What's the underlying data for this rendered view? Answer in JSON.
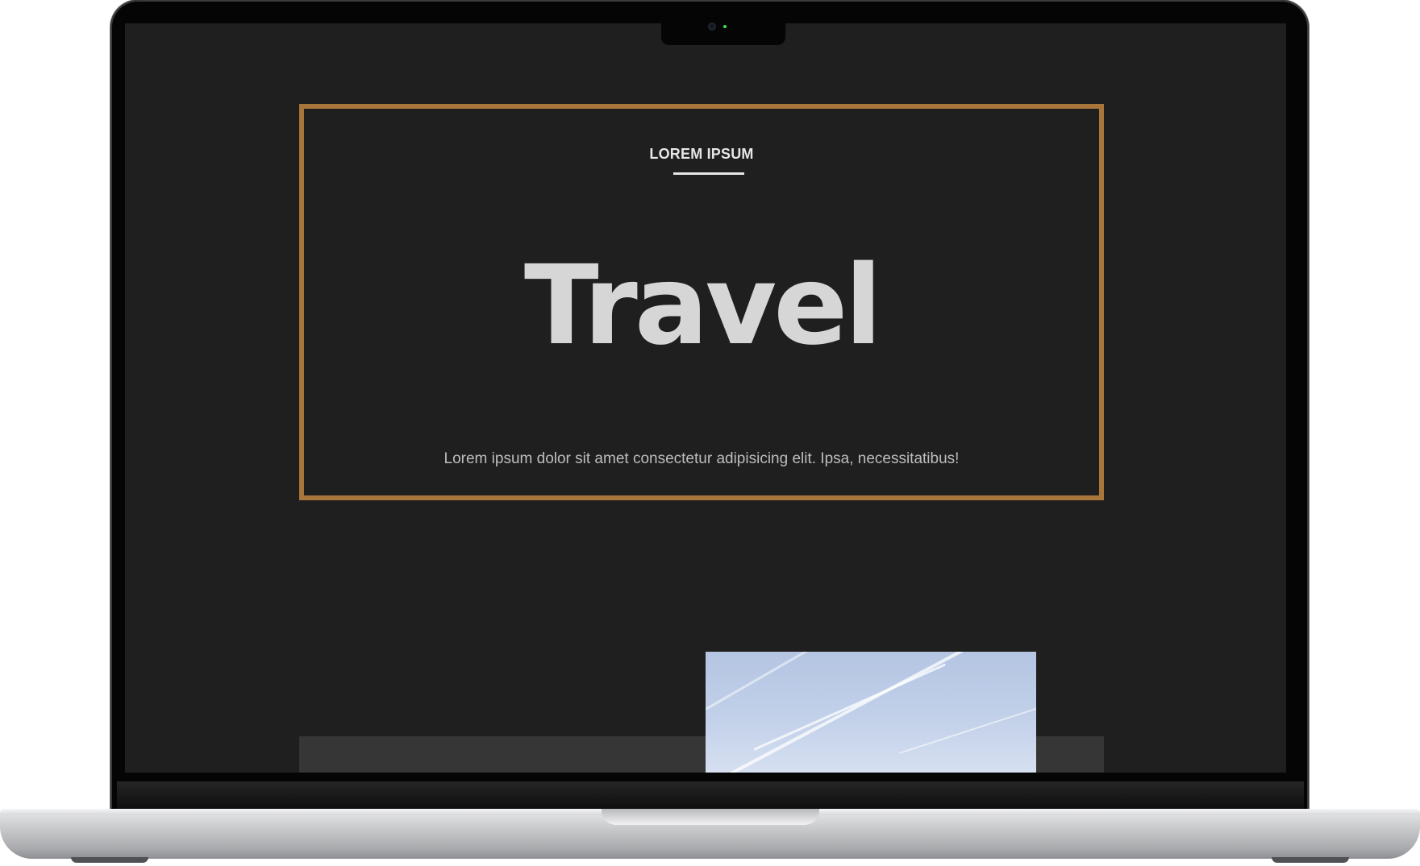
{
  "hero": {
    "eyebrow": "LOREM IPSUM",
    "title": "Travel",
    "subtitle": "Lorem ipsum dolor sit amet consectetur adipisicing elit. Ipsa, necessitatibus!"
  },
  "colors": {
    "page_background": "#1f1f1f",
    "frame_accent": "#a8763a",
    "title_text": "#d6d6d6",
    "strip_background": "#363636",
    "sky_photo": "#b4c5e2"
  },
  "device": {
    "type": "laptop-mockup",
    "indicator_light": "#3ee04a"
  },
  "icons": {
    "camera": "camera-icon"
  }
}
